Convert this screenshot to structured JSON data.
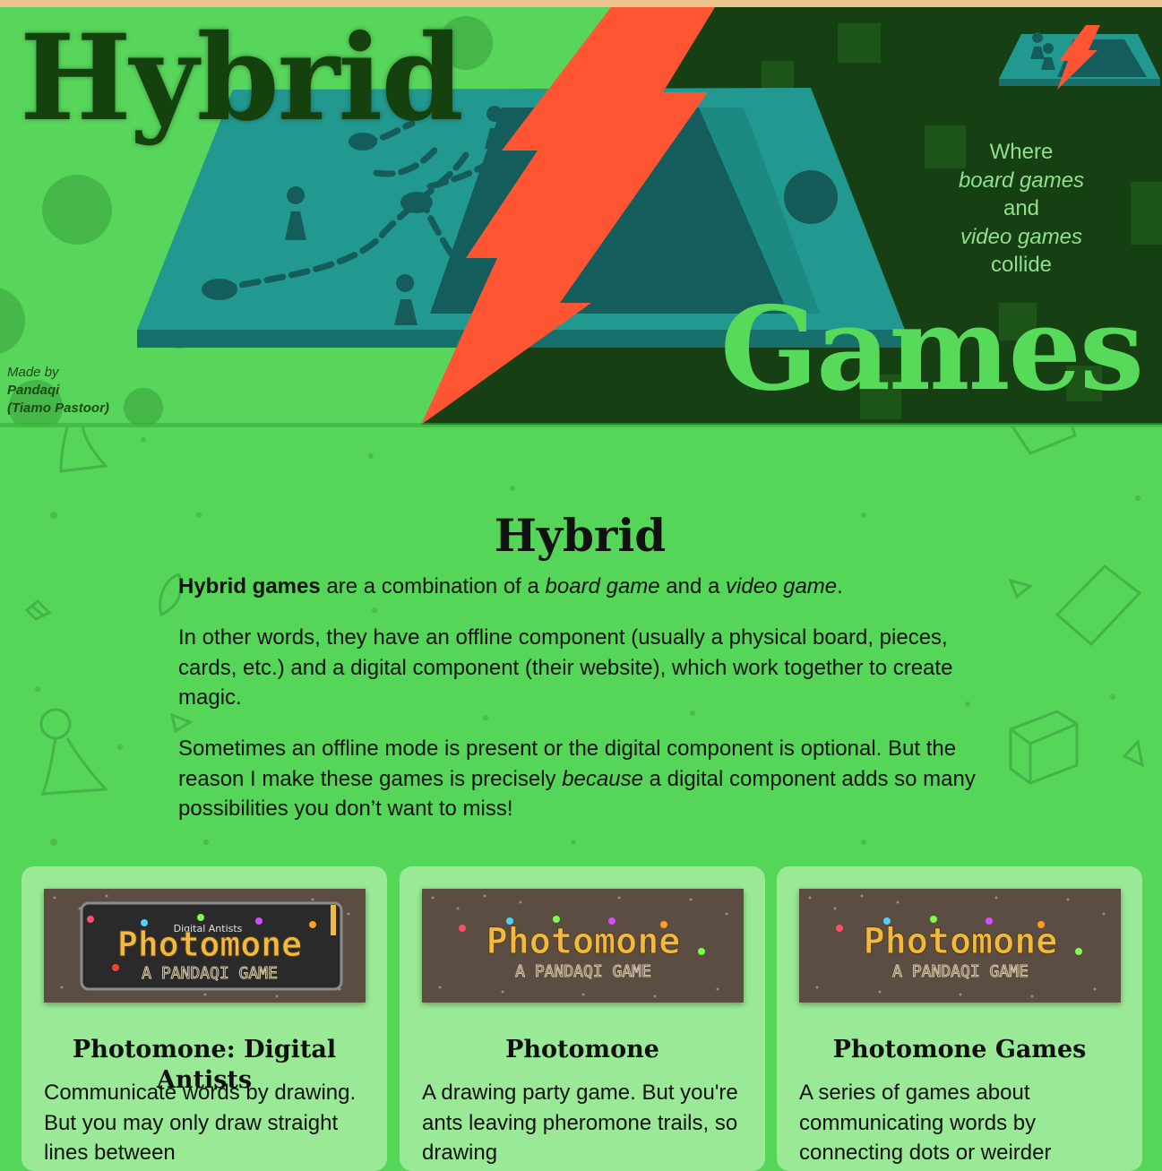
{
  "hero": {
    "title_left": "Hybrid",
    "title_right": "Games",
    "tagline": {
      "line1": "Where",
      "line2": "board games",
      "line3": "and",
      "line4": "video games",
      "line5": "collide"
    },
    "credit": {
      "made_by": "Made by",
      "name": "Pandaqi",
      "real_name": "(Tiamo Pastoor)"
    },
    "logo_icon": "board-with-lightning-icon"
  },
  "intro": {
    "heading": "Hybrid",
    "p1_bold": "Hybrid games",
    "p1_a": " are a combination of a ",
    "p1_it1": "board game",
    "p1_b": " and a ",
    "p1_it2": "video game",
    "p1_c": ".",
    "p2": "In other words, they have an offline component (usually a physical board, pieces, cards, etc.) and a digital component (their website), which work together to create magic.",
    "p3_a": "Sometimes an offline mode is present or the digital component is optional. But the reason I make these games is precisely ",
    "p3_it": "because",
    "p3_b": " a digital component adds so many possibilities you don’t want to miss!"
  },
  "cards": [
    {
      "title": "Photomone: Digital Antists",
      "desc": "Communicate words by drawing. But you may only draw straight lines between",
      "thumb_title": "Photomone",
      "thumb_subtitle": "A PANDAQI GAME",
      "thumb_badge": "Digital Antists"
    },
    {
      "title": "Photomone",
      "desc": "A drawing party game. But you're ants leaving pheromone trails, so drawing",
      "thumb_title": "Photomone",
      "thumb_subtitle": "A PANDAQI GAME"
    },
    {
      "title": "Photomone Games",
      "desc": "A series of games about communicating words by connecting dots or weirder",
      "thumb_title": "Photomone",
      "thumb_subtitle": "A PANDAQI GAME"
    }
  ],
  "colors": {
    "page_bg": "#55d659",
    "hero_dark": "#163f13",
    "board_teal": "#229990",
    "lightning": "#ff5533",
    "card_bg": "#9ae996",
    "thumb_bg": "#5c4d42",
    "thumb_text": "#f0b940"
  }
}
